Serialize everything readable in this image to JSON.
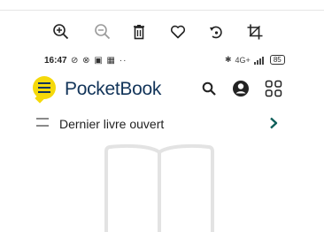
{
  "toolbar": {
    "icons": [
      "zoom-in-icon",
      "zoom-out-icon",
      "trash-icon",
      "heart-icon",
      "rotate-icon",
      "crop-icon"
    ]
  },
  "status_bar": {
    "time": "16:47",
    "left_icons": "⊘ ⊗ ▣ ▦ ··",
    "signal_text": "4G+",
    "battery": "85"
  },
  "app": {
    "name": "PocketBook"
  },
  "section": {
    "title": "Dernier livre ouvert"
  },
  "colors": {
    "accent": "#f5d90a",
    "brand": "#13355a",
    "chevron": "#0f5f5a"
  }
}
